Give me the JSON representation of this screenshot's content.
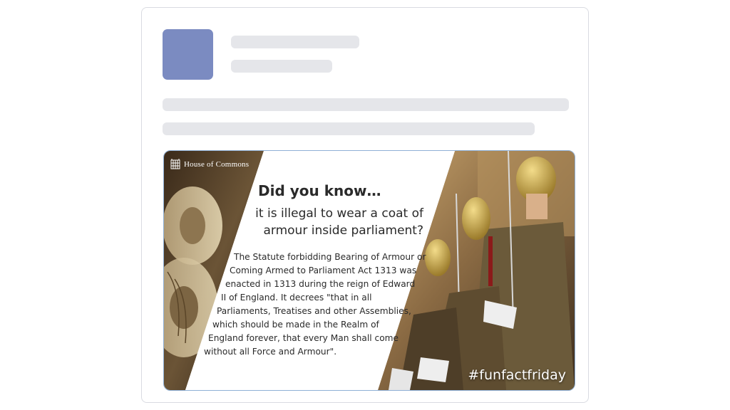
{
  "post": {
    "brand": {
      "label": "House of Commons",
      "icon": "portcullis-icon"
    },
    "headline": "Did you know…",
    "question_lines": [
      "it is illegal to wear a coat of",
      "armour inside parliament?"
    ],
    "body_lines": [
      "The Statute forbidding Bearing of Armour or",
      "Coming Armed to Parliament Act 1313 was",
      "enacted in 1313 during the reign of Edward",
      "II of England. It decrees \"that in all",
      "Parliaments, Treatises and other Assemblies,",
      "which should be made in the Realm of",
      "England forever, that every Man shall come",
      "without all Force and Armour\"."
    ],
    "hashtag": "#funfactfriday"
  },
  "colors": {
    "avatar": "#7b8bc1",
    "skeleton": "#e5e6ea",
    "media_border": "#8fb0d6"
  }
}
